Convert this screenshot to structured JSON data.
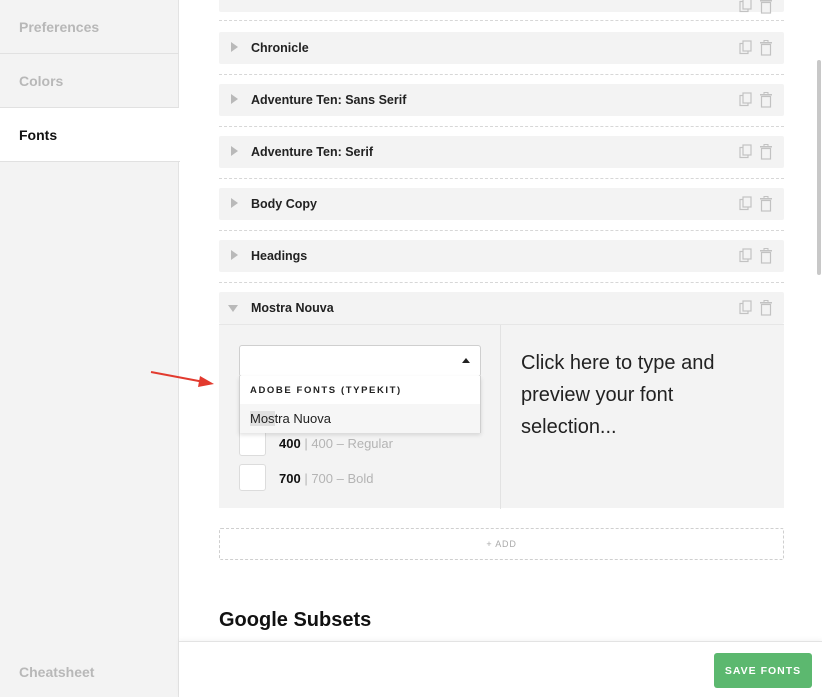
{
  "sidebar": {
    "items": [
      {
        "label": "Preferences"
      },
      {
        "label": "Colors"
      },
      {
        "label": "Fonts"
      }
    ],
    "bottom_item": {
      "label": "Cheatsheet"
    }
  },
  "fonts": {
    "rows": [
      {
        "title": "Chronicle"
      },
      {
        "title": "Adventure Ten: Sans Serif"
      },
      {
        "title": "Adventure Ten: Serif"
      },
      {
        "title": "Body Copy"
      },
      {
        "title": "Headings"
      },
      {
        "title": "Mostra Nouva"
      }
    ],
    "expanded": {
      "select": {
        "value": ""
      },
      "dropdown": {
        "group_label": "ADOBE FONTS (TYPEKIT)",
        "option_highlight": "Mos",
        "option_rest": "tra Nuova"
      },
      "weights": [
        {
          "value": "400",
          "separator": " | ",
          "description": "400 – Regular"
        },
        {
          "value": "700",
          "separator": " | ",
          "description": "700 – Bold"
        }
      ],
      "preview_text": "Click here to type and preview your font selection..."
    },
    "add_label": "+ ADD"
  },
  "google_subsets": {
    "heading": "Google Subsets"
  },
  "footer": {
    "save_label": "SAVE FONTS"
  },
  "colors": {
    "accent": "#5cb86f",
    "annotation_arrow": "#e23a2e"
  },
  "icons": [
    "copy-icon",
    "trash-icon",
    "caret-right-icon",
    "caret-down-icon",
    "select-arrow-icon"
  ]
}
